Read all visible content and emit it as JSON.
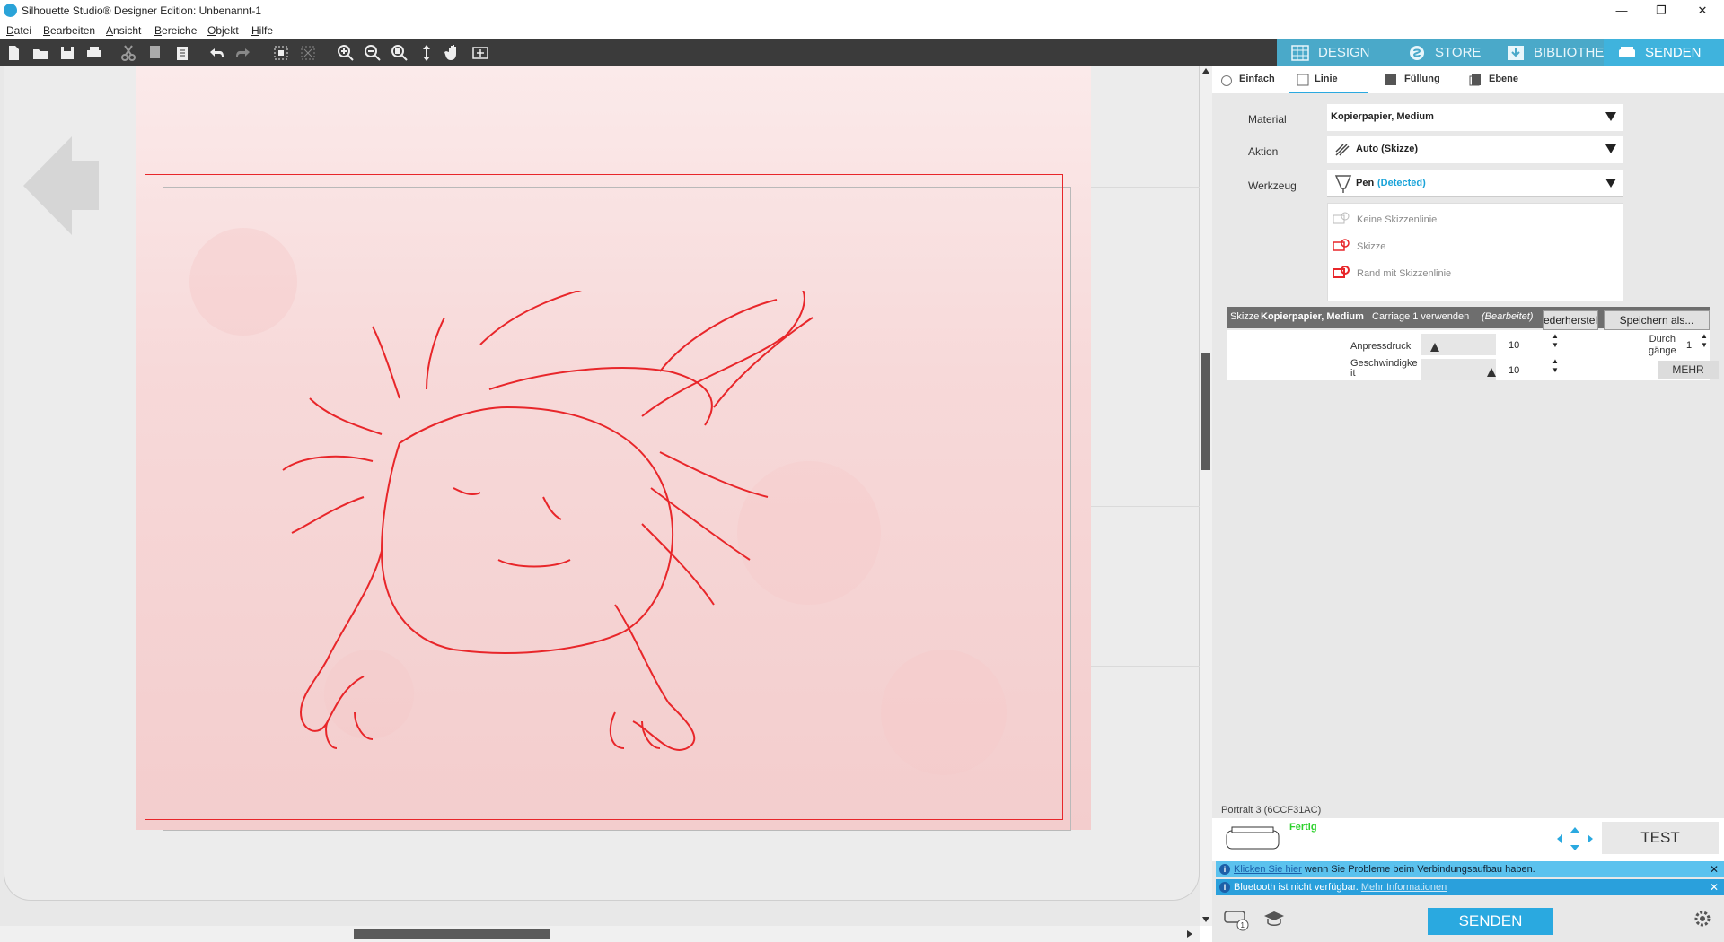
{
  "window": {
    "title": "Silhouette Studio® Designer Edition: Unbenannt-1",
    "minimize": "—",
    "maximize": "❐",
    "close": "✕"
  },
  "menu": [
    "Datei",
    "Bearbeiten",
    "Ansicht",
    "Bereiche",
    "Objekt",
    "Hilfe"
  ],
  "main_tabs": {
    "design": "DESIGN",
    "store": "STORE",
    "bibliothek": "BIBLIOTHEK",
    "senden": "SENDEN",
    "active": "SENDEN",
    "active_color": "#3fb3dd"
  },
  "send_modes": {
    "einfach": "Einfach",
    "linie": "Linie",
    "fuellung": "Füllung",
    "ebene": "Ebene"
  },
  "settings": {
    "material_label": "Material",
    "material_value": "Kopierpapier, Medium",
    "aktion_label": "Aktion",
    "aktion_value": "Auto (Skizze)",
    "werkzeug_label": "Werkzeug",
    "werkzeug_value": "Pen",
    "werkzeug_status": "(Detected)",
    "options": [
      "Keine Skizzenlinie",
      "Skizze",
      "Rand mit Skizzenlinie"
    ]
  },
  "preset": {
    "prefix": "Skizze",
    "material": "Kopierpapier, Medium",
    "carriage": "Carriage 1 verwenden",
    "state": "(Bearbeitet)",
    "restore_button": "ederherstel",
    "save_button": "Speichern als..."
  },
  "blade": {
    "anpressdruck_label": "Anpressdruck",
    "anpressdruck_value": "10",
    "anpressdruck_level": 0.15,
    "geschwindigkeit_label_1": "Geschwindigke",
    "geschwindigkeit_label_2": "it",
    "geschwindigkeit_value": "10",
    "geschwindigkeit_level": 1.0,
    "durchgaenge_label_1": "Durch",
    "durchgaenge_label_2": "gänge",
    "durchgaenge_value": "1",
    "mehr_button": "MEHR"
  },
  "device": {
    "name": "Portrait 3 (6CCF31AC)",
    "status": "Fertig",
    "status_color": "#2bd12b",
    "test_button": "TEST"
  },
  "notices": [
    {
      "link": "Klicken Sie hier",
      "text": "wenn Sie Probleme beim Verbindungsaufbau haben."
    },
    {
      "text": "Bluetooth ist nicht verfügbar.",
      "link": "Mehr Informationen"
    }
  ],
  "send_button": "SENDEN",
  "colors": {
    "cut_line": "#e8262a",
    "accent": "#2aa9e0"
  }
}
